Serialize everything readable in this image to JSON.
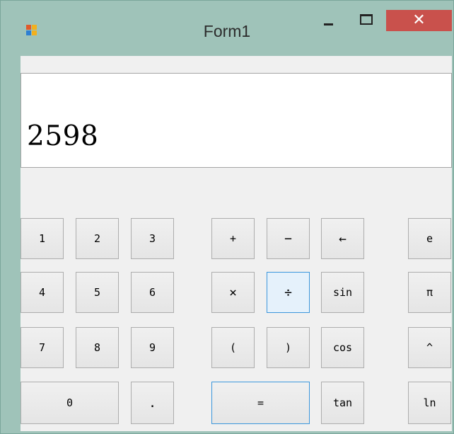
{
  "window": {
    "title": "Form1"
  },
  "title_controls": {
    "close_glyph": "✕"
  },
  "display": {
    "value": "2598"
  },
  "keys": {
    "one": "1",
    "two": "2",
    "three": "3",
    "four": "4",
    "five": "5",
    "six": "6",
    "seven": "7",
    "eight": "8",
    "nine": "9",
    "zero": "0",
    "dot": ".",
    "plus": "+",
    "minus": "−",
    "backspace": "←",
    "times": "×",
    "divide": "÷",
    "open_paren": "(",
    "close_paren": ")",
    "equals": "=",
    "sin": "sin",
    "cos": "cos",
    "tan": "tan",
    "e": "e",
    "pi": "π",
    "power": "^",
    "ln": "ln"
  },
  "colors": {
    "frame": "#9fc3b9",
    "close_button": "#c9514c",
    "client_bg": "#f0f0f0",
    "focus_border": "#3b96dc"
  }
}
